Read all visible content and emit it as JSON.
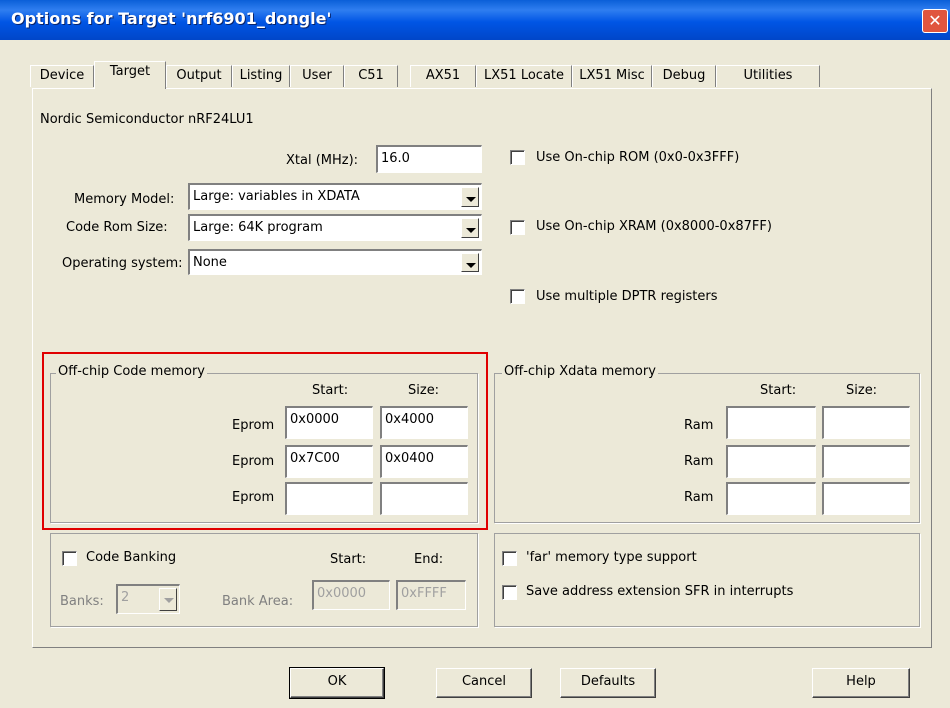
{
  "window": {
    "title": "Options for Target 'nrf6901_dongle'",
    "close_glyph": "✕"
  },
  "tabs": [
    {
      "label": "Device"
    },
    {
      "label": "Target"
    },
    {
      "label": "Output"
    },
    {
      "label": "Listing"
    },
    {
      "label": "User"
    },
    {
      "label": "C51"
    },
    {
      "label": "AX51"
    },
    {
      "label": "LX51 Locate"
    },
    {
      "label": "LX51 Misc"
    },
    {
      "label": "Debug"
    },
    {
      "label": "Utilities"
    }
  ],
  "device_name": "Nordic Semiconductor nRF24LU1",
  "xtal": {
    "label": "Xtal (MHz):",
    "value": "16.0"
  },
  "memory_model": {
    "label": "Memory Model:",
    "value": "Large: variables in XDATA"
  },
  "code_rom_size": {
    "label": "Code Rom Size:",
    "value": "Large: 64K program"
  },
  "operating_system": {
    "label": "Operating system:",
    "value": "None"
  },
  "checkboxes": {
    "onchip_rom": "Use On-chip ROM (0x0-0x3FFF)",
    "onchip_xram": "Use On-chip XRAM (0x8000-0x87FF)",
    "multiple_dptr": "Use multiple DPTR registers"
  },
  "offchip_code": {
    "title": "Off-chip Code memory",
    "start_header": "Start:",
    "size_header": "Size:",
    "rows": [
      {
        "label": "Eprom",
        "start": "0x0000",
        "size": "0x4000"
      },
      {
        "label": "Eprom",
        "start": "0x7C00",
        "size": "0x0400"
      },
      {
        "label": "Eprom",
        "start": "",
        "size": ""
      }
    ]
  },
  "offchip_xdata": {
    "title": "Off-chip Xdata memory",
    "start_header": "Start:",
    "size_header": "Size:",
    "rows": [
      {
        "label": "Ram",
        "start": "",
        "size": ""
      },
      {
        "label": "Ram",
        "start": "",
        "size": ""
      },
      {
        "label": "Ram",
        "start": "",
        "size": ""
      }
    ]
  },
  "banking": {
    "code_banking": "Code Banking",
    "start_header": "Start:",
    "end_header": "End:",
    "banks_label": "Banks:",
    "banks_value": "2",
    "bank_area_label": "Bank Area:",
    "bank_area_start": "0x0000",
    "bank_area_end": "0xFFFF"
  },
  "far_memory": {
    "far_support": "'far' memory type support",
    "save_sfr": "Save address extension SFR in interrupts"
  },
  "buttons": {
    "ok": "OK",
    "cancel": "Cancel",
    "defaults": "Defaults",
    "help": "Help"
  },
  "colors": {
    "titlebar": "#0055e5",
    "highlight": "#e00000",
    "face": "#ece9d8"
  }
}
